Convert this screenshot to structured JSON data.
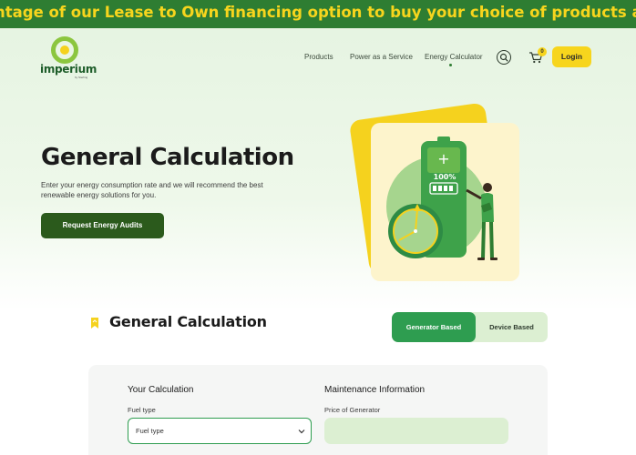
{
  "ticker": {
    "text": "ntage of our Lease to Own financing option to buy your choice of products and solution. Ter"
  },
  "brand": {
    "name": "imperium",
    "sub": "by Sterling"
  },
  "nav": {
    "items": [
      {
        "label": "Products"
      },
      {
        "label": "Power as a Service"
      },
      {
        "label": "Energy Calculator"
      }
    ],
    "cart_count": "0",
    "login_label": "Login"
  },
  "hero": {
    "title": "General Calculation",
    "description": "Enter your energy consumption rate and we will recommend the best renewable energy solutions for you.",
    "cta_label": "Request Energy Audits",
    "battery_label": "100%"
  },
  "calculator": {
    "title": "General Calculation",
    "tabs": [
      {
        "label": "Generator Based",
        "active": true
      },
      {
        "label": "Device Based",
        "active": false
      }
    ],
    "left_heading": "Your Calculation",
    "right_heading": "Maintenance Information",
    "fuel_label": "Fuel type",
    "fuel_value": "Fuel type",
    "price_label": "Price of Generator",
    "price_value": ""
  },
  "colors": {
    "ticker_bg": "#2e7d32",
    "ticker_text": "#f7d51d",
    "accent_green": "#2e9d50",
    "dark_green": "#2b5a1c",
    "yellow": "#f7d51d"
  }
}
